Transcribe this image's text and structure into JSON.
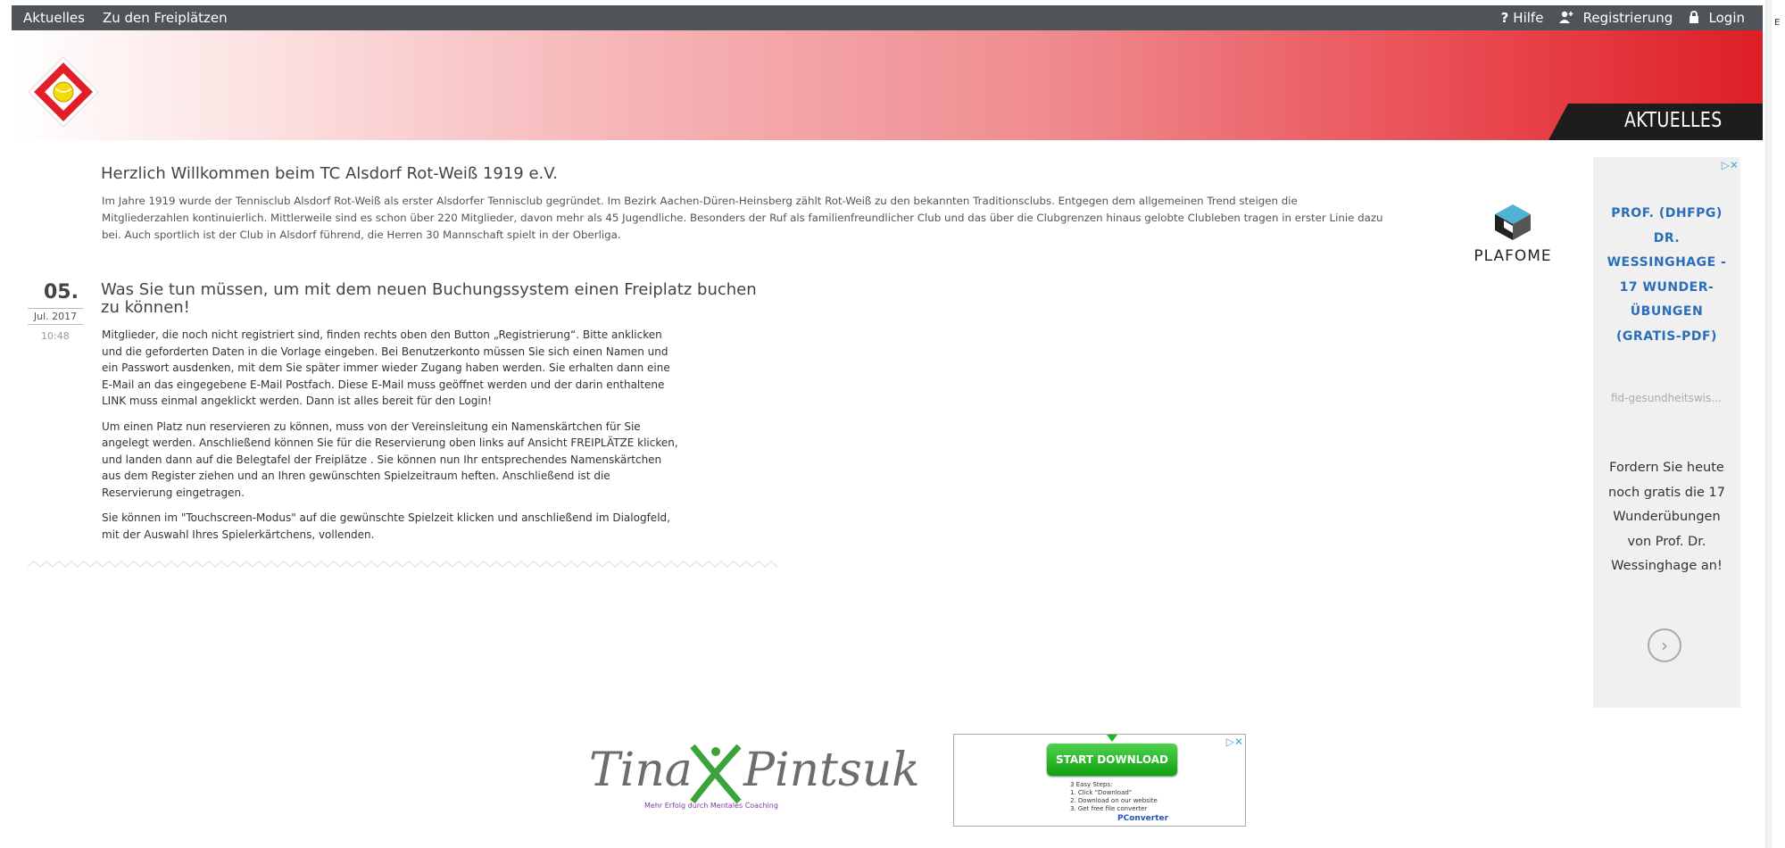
{
  "nav": {
    "left": [
      "Aktuelles",
      "Zu den Freiplätzen"
    ],
    "help": "Hilfe",
    "register": "Registrierung",
    "login": "Login"
  },
  "edge_letter": "E",
  "header": {
    "tab_label": "AKTUELLES"
  },
  "welcome": {
    "title": "Herzlich Willkommen beim TC Alsdorf Rot-Weiß 1919 e.V.",
    "text": "Im Jahre 1919 wurde der Tennisclub Alsdorf Rot-Weiß als erster Alsdorfer Tennisclub gegründet. Im Bezirk Aachen-Düren-Heinsberg zählt Rot-Weiß zu den bekannten Traditionsclubs. Entgegen dem allgemeinen Trend steigen die Mitgliederzahlen kontinuierlich. Mittlerweile sind es schon über 220 Mitglieder, davon mehr als 45 Jugendliche. Besonders der Ruf als familienfreundlicher Club und das über die Clubgrenzen hinaus gelobte Clubleben tragen in erster Linie dazu bei. Auch sportlich ist der Club in Alsdorf führend, die Herren 30 Mannschaft spielt in der Oberliga."
  },
  "plafome": {
    "label": "PLAFOME"
  },
  "post": {
    "day": "05.",
    "month": "Jul. 2017",
    "time": "10:48",
    "title": "Was Sie tun müssen, um mit dem neuen Buchungssystem einen Freiplatz buchen zu können!",
    "paragraphs": [
      "Mitglieder, die noch nicht registriert sind, finden rechts oben den Button „Registrierung“. Bitte anklicken und die geforderten Daten in die Vorlage eingeben. Bei Benutzerkonto müssen Sie sich einen Namen und ein Passwort ausdenken, mit dem Sie später immer wieder Zugang haben werden. Sie erhalten dann eine E-Mail an das eingegebene E-Mail Postfach. Diese E-Mail muss geöffnet werden und der darin enthaltene LINK muss einmal angeklickt werden. Dann ist alles bereit für den Login!",
      "Um einen Platz nun reservieren zu können, muss von der Vereinsleitung ein Namenskärtchen für Sie angelegt werden. Anschließend können Sie für die  Reservierung oben links auf Ansicht FREIPLÄTZE klicken, und landen dann auf die Belegtafel der Freiplätze . Sie können nun Ihr entsprechendes Namenskärtchen aus dem Register ziehen und an Ihren gewünschten Spielzeitraum heften. Anschließend ist die Reservierung eingetragen.",
      "Sie können im \"Touchscreen-Modus\" auf die gewünschte Spielzeit klicken und anschließend im Dialogfeld, mit der Auswahl Ihres Spielerkärtchens, vollenden."
    ]
  },
  "ad_right": {
    "adchoices": "▷✕",
    "headline": "PROF. (DHFPG) DR. WESSINGHAGE - 17 WUNDER-ÜBUNGEN (GRATIS-PDF)",
    "domain": "fid-gesundheitswis...",
    "description": "Fordern Sie heute noch gratis die 17 Wunderübungen von Prof. Dr. Wessinghage an!"
  },
  "bottom": {
    "tina_first": "Tina",
    "tina_last": "Pintsuk",
    "tina_sub": "Mehr Erfolg durch Mentales Coaching",
    "ad": {
      "adchoices": "▷✕",
      "button": "START DOWNLOAD",
      "steps_title": "3 Easy Steps:",
      "step1": "1. Click \"Download\"",
      "step2": "2. Download on our website",
      "step3": "3. Get free file converter",
      "brand": "PConverter"
    }
  },
  "colors": {
    "nav_bg": "#4e5458",
    "header_red": "#dd1f26",
    "tab_bg": "#1d1d1d",
    "ad_headline": "#2a6ebb",
    "download_green": "#22b322"
  }
}
